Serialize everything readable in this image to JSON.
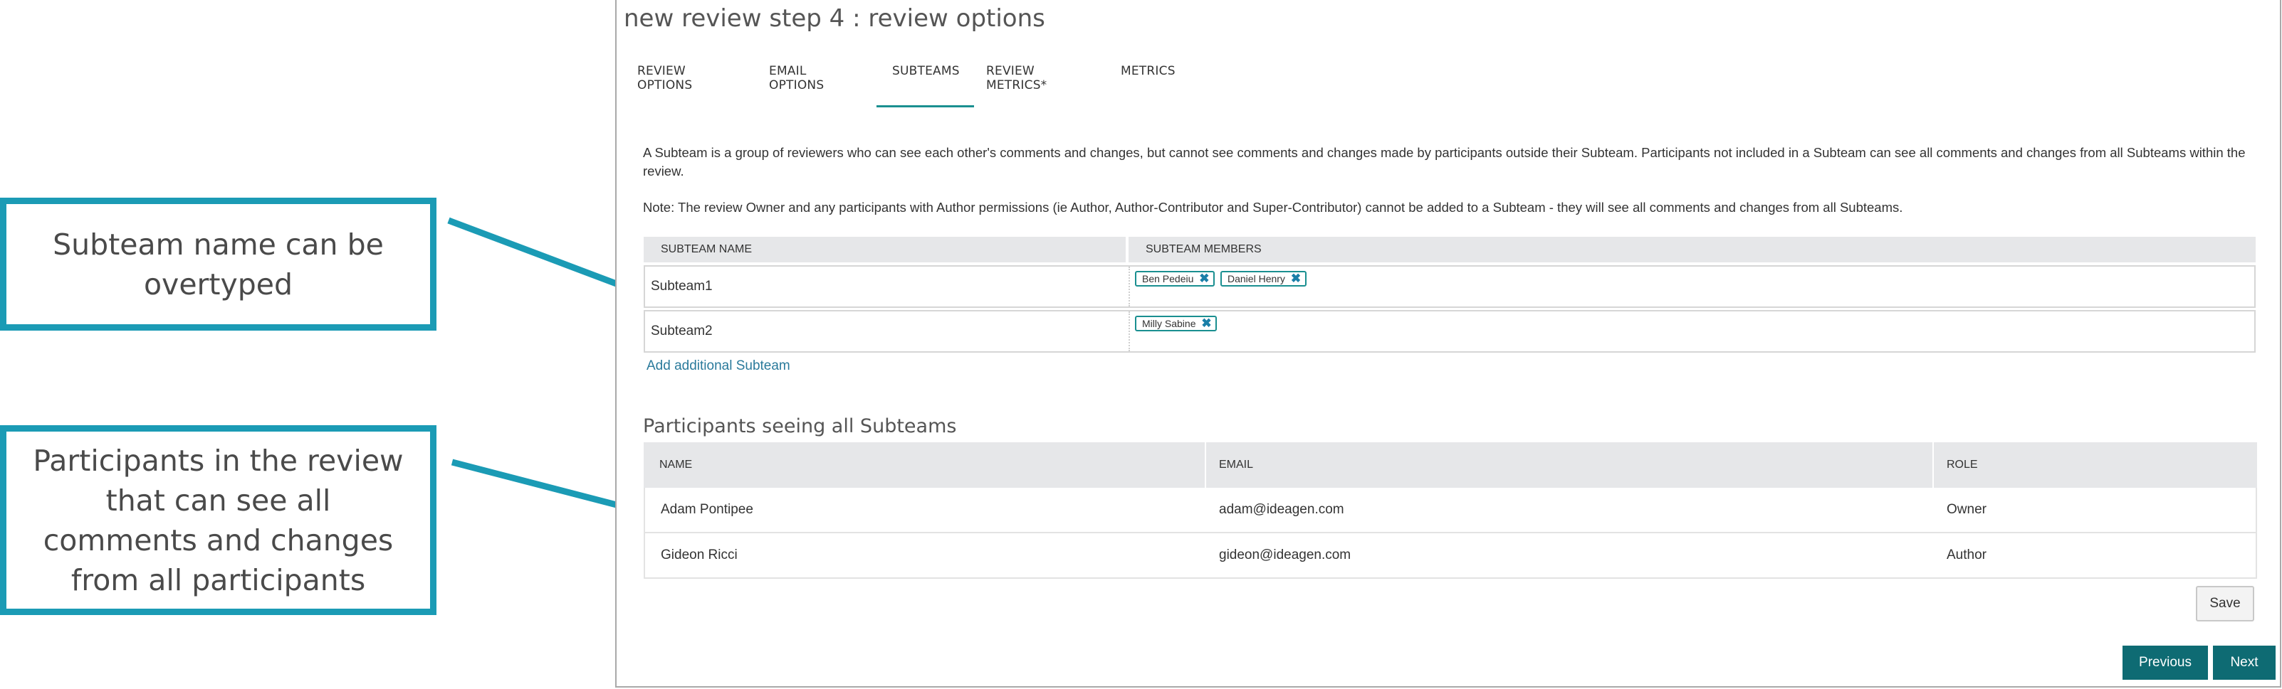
{
  "callouts": {
    "subteam_name": "Subteam name can be overtyped",
    "participants": "Participants in the review that can see all comments and changes from all participants"
  },
  "colors": {
    "accent": "#1b9bb5",
    "primary_button": "#0e6b73",
    "tab_underline": "#1a8f90"
  },
  "page_title": "new review step 4 : review options",
  "tabs": [
    {
      "label": "REVIEW OPTIONS",
      "active": false
    },
    {
      "label": "EMAIL OPTIONS",
      "active": false
    },
    {
      "label": "SUBTEAMS",
      "active": true
    },
    {
      "label": "REVIEW METRICS*",
      "active": false
    },
    {
      "label": "METRICS",
      "active": false
    }
  ],
  "description": "A Subteam is a group of reviewers who can see each other's comments and changes, but cannot see comments and changes made by participants outside their Subteam. Participants not included in a Subteam can see all comments and changes from all Subteams within the review.",
  "note": "Note: The review Owner and any participants with Author permissions (ie Author, Author-Contributor and Super-Contributor) cannot be added to a Subteam - they will see all comments and changes from all Subteams.",
  "subteams_table": {
    "headers": {
      "name": "SUBTEAM NAME",
      "members": "SUBTEAM MEMBERS"
    },
    "rows": [
      {
        "name": "Subteam1",
        "members": [
          "Ben Pedeiu",
          "Daniel Henry"
        ]
      },
      {
        "name": "Subteam2",
        "members": [
          "Milly Sabine"
        ]
      }
    ]
  },
  "add_subteam_link": "Add additional Subteam",
  "participants_section": {
    "title": "Participants seeing all Subteams",
    "headers": {
      "name": "NAME",
      "email": "EMAIL",
      "role": "ROLE"
    },
    "rows": [
      {
        "name": "Adam Pontipee",
        "email": "adam@ideagen.com",
        "role": "Owner"
      },
      {
        "name": "Gideon Ricci",
        "email": "gideon@ideagen.com",
        "role": "Author"
      }
    ]
  },
  "buttons": {
    "save": "Save",
    "previous": "Previous",
    "next": "Next"
  },
  "icons": {
    "chip_remove": "close-icon"
  }
}
